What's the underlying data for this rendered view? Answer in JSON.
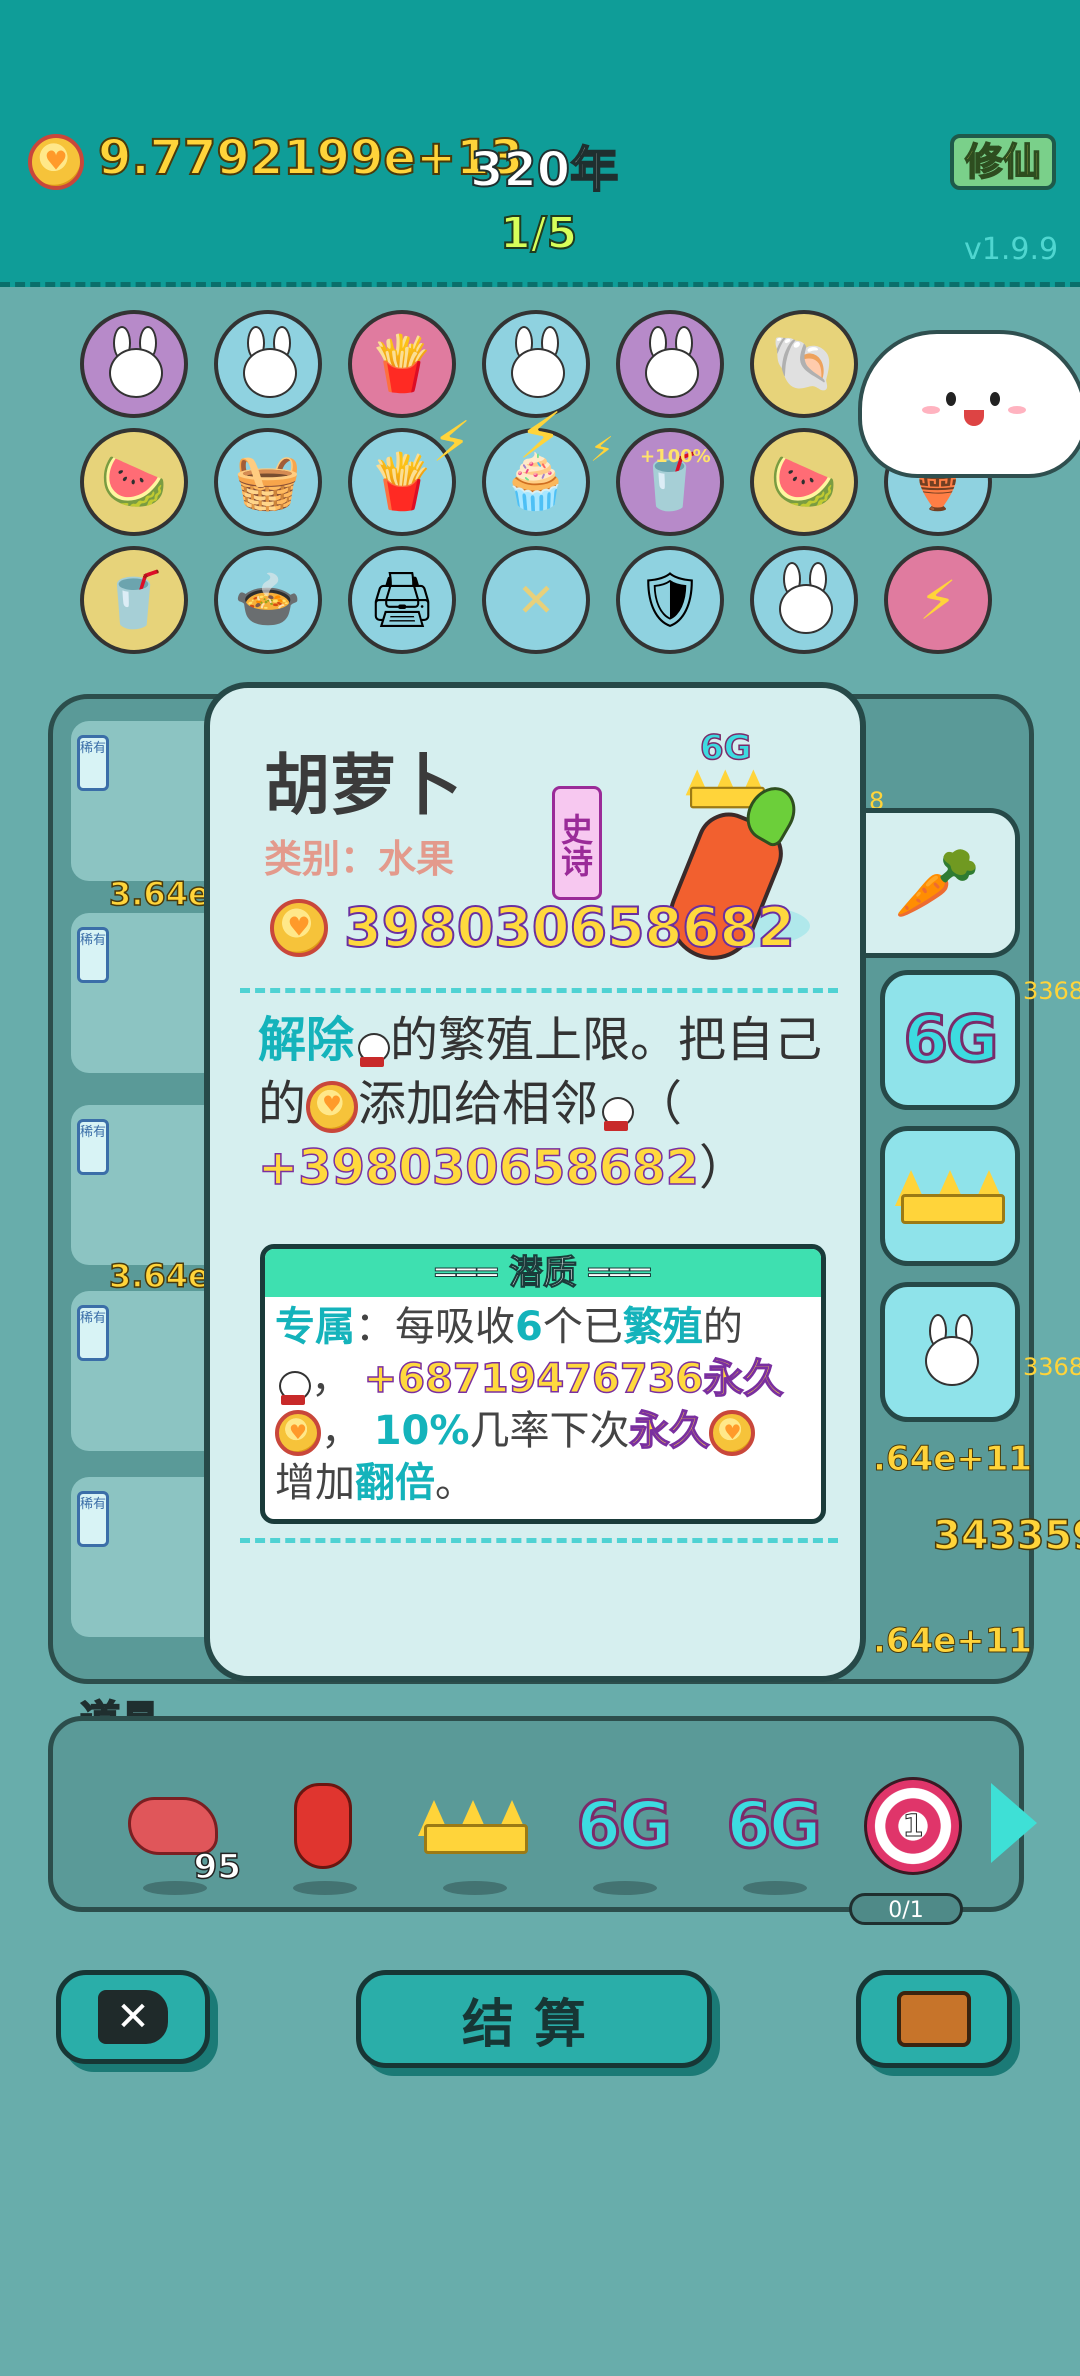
{
  "topbar": {
    "currency_value": "9.7792199e+13",
    "years": "320年",
    "page_indicator": "1/5",
    "cultivate_button": "修仙",
    "version": "v1.9.9"
  },
  "icon_grid": [
    "bunny-icon",
    "bunny-icon",
    "fries-icon",
    "bunny-icon",
    "bunny-icon",
    "shell-icon",
    "cloud-icon",
    "fruit-bowl-icon",
    "basket-icon",
    "fries-icon",
    "pleated-cup-icon",
    "cup-icon",
    "fruit-bowl-icon",
    "golden-pot-icon",
    "cup-icon",
    "pot-icon",
    "printer-icon",
    "straws-icon",
    "shield-icon",
    "bunny-icon",
    "lightning-icon"
  ],
  "grid_effects": {
    "bonus_label": "+100%"
  },
  "collection": {
    "rarity_badge": "稀有",
    "cards": [
      {
        "value": "3.64e+"
      },
      {
        "value": ""
      },
      {
        "value": "3.64e+"
      },
      {
        "value": ""
      },
      {
        "value": ""
      }
    ],
    "right_values": [
      "8",
      "3368",
      ".64e+11",
      "3368",
      "343359",
      ".64e+11",
      ".64e+11"
    ]
  },
  "popup": {
    "title": "胡萝卜",
    "category": "类别：水果",
    "rarity": "史诗",
    "value": "398030658682",
    "level_badge": "6G",
    "description": {
      "remove": "解除",
      "part1": "的繁殖上限。把自己的",
      "part2": "添加给相邻",
      "part3": "（",
      "bonus": "+398030658682",
      "part4": "）"
    },
    "potential": {
      "header": "═══ 潜质 ═══",
      "exclusive": "专属",
      "t1": "：每吸收",
      "count": "6",
      "t2": "个已",
      "bred": "繁殖",
      "t3": "的",
      "t4": "，",
      "gain": "+68719476736永久",
      "t5": "，",
      "chance": "10%",
      "t6": "几率下次",
      "perm": "永久",
      "t7": "增加",
      "double": "翻倍",
      "t8": "。"
    }
  },
  "side_tabs": [
    "carrot-icon",
    "6G",
    "crown-icon",
    "bunny-icon"
  ],
  "items": {
    "section_label": "道具",
    "list": [
      {
        "icon": "liver-icon",
        "count": "95"
      },
      {
        "icon": "pepper-icon",
        "count": ""
      },
      {
        "icon": "crown-icon",
        "count": ""
      },
      {
        "icon": "6G",
        "count": ""
      },
      {
        "icon": "6G",
        "count": ""
      },
      {
        "icon": "target-icon",
        "count": "1",
        "progress": "0/1"
      }
    ]
  },
  "bottom": {
    "settle_label": "结算"
  },
  "colors": {
    "topbar": "#0f9d98",
    "background": "#68adab",
    "accent_gold": "#ffd93d",
    "accent_teal": "#14b3bb",
    "rarity_purple": "#9a2b98"
  }
}
